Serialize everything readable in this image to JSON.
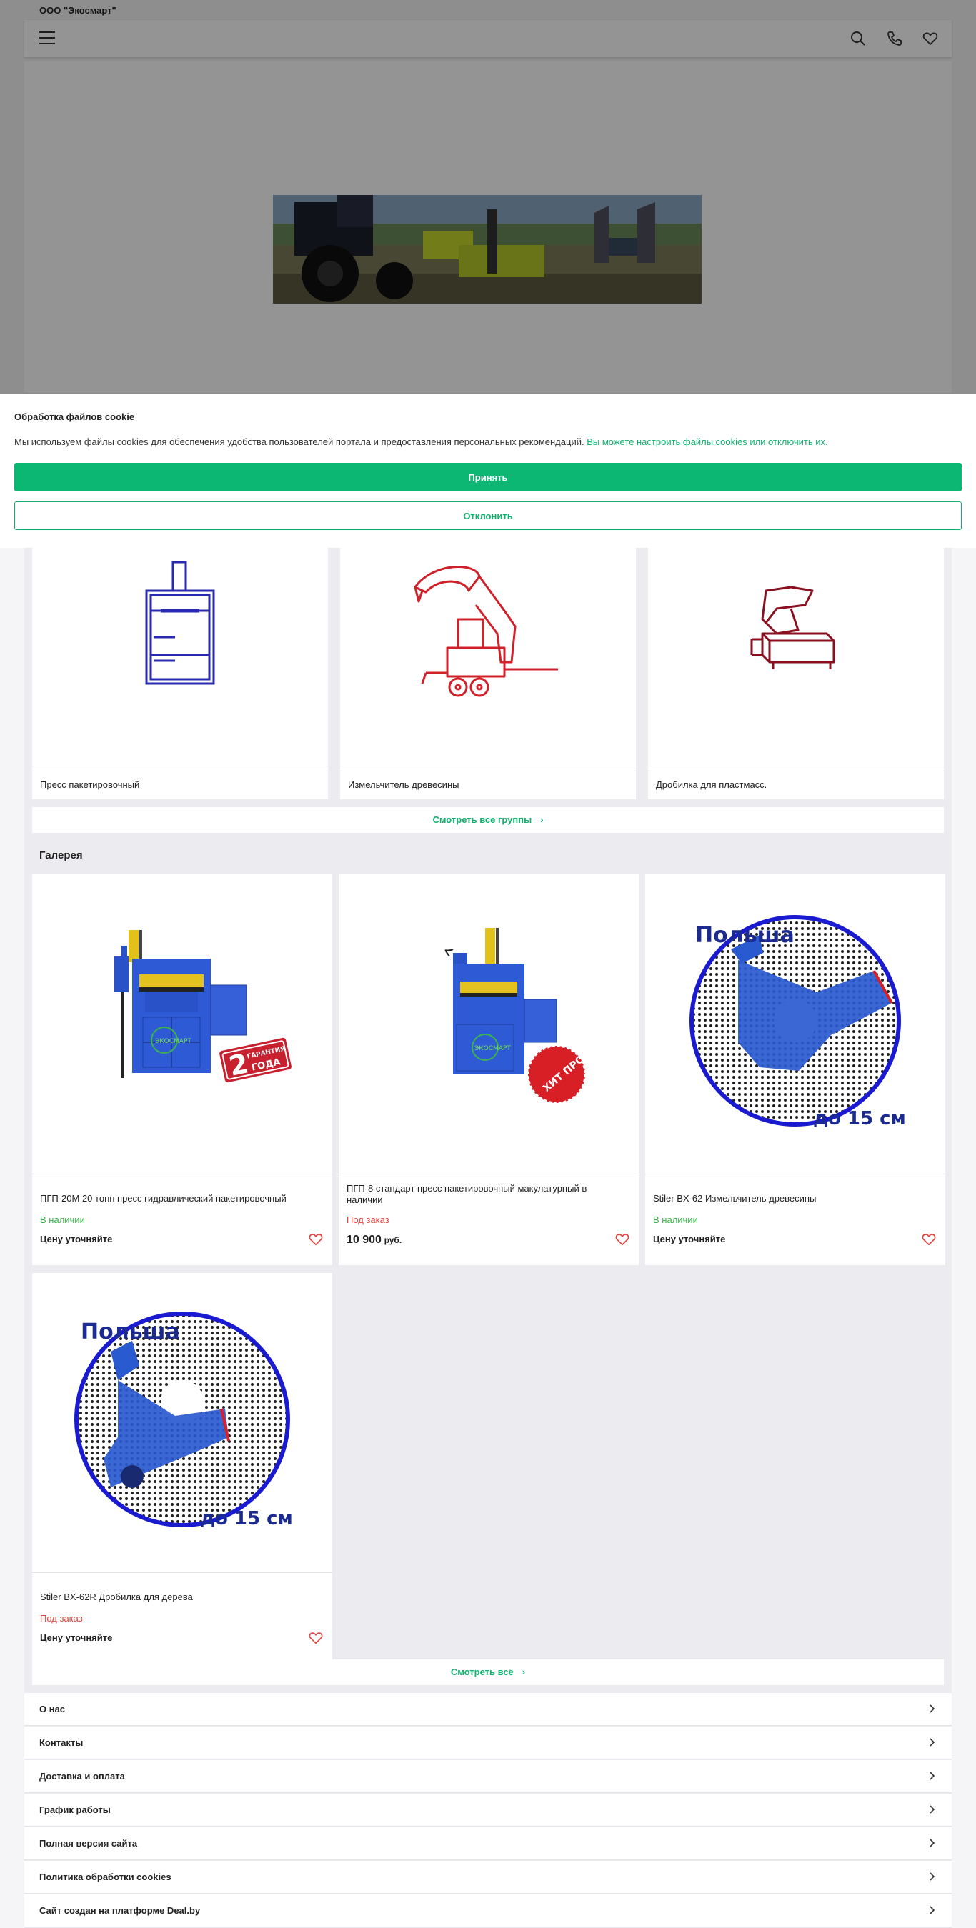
{
  "header": {
    "company": "ООО \"Экосмарт\"",
    "icons": [
      "menu-icon",
      "search-icon",
      "phone-icon",
      "heart-icon"
    ]
  },
  "cookie": {
    "title": "Обработка файлов cookie",
    "text": "Мы используем файлы cookies для обеспечения удобства пользователей портала и предоставления персональных рекомендаций.",
    "link": "Вы можете настроить файлы cookies или отключить их.",
    "accept": "Принять",
    "decline": "Отклонить"
  },
  "categories": [
    {
      "label": "Пресс пакетировочный",
      "icon": "baling-press-icon"
    },
    {
      "label": "Измельчитель древесины",
      "icon": "wood-chipper-icon"
    },
    {
      "label": "Дробилка для пластмасс.",
      "icon": "plastic-crusher-icon"
    }
  ],
  "see_all_groups": "Смотреть все группы",
  "gallery": {
    "title": "Галерея",
    "products": [
      {
        "name": "ПГП-20М 20 тонн пресс гидравлический пакетировочный",
        "status": "В наличии",
        "price": "Цену уточняйте",
        "badge_line1": "ГАРАНТИЯ",
        "badge_num": "2",
        "badge_line2": "ГОДА",
        "logo": "ЭКОСМАРТ"
      },
      {
        "name": "ПГП-8 стандарт пресс пакетировочный макулатурный в наличии",
        "status": "Под заказ",
        "price_value": "10 900",
        "currency": "руб.",
        "badge": "ХИТ ПРОДАЖ",
        "logo": "ЭКОСМАРТ"
      },
      {
        "name": "Stiler BX-62 Измельчитель древесины",
        "status": "В наличии",
        "price": "Цену уточняйте",
        "top_text": "Польша",
        "bottom_text": "до 15 см"
      },
      {
        "name": "Stiler BX-62R Дробилка для дерева",
        "status": "Под заказ",
        "price": "Цену уточняйте",
        "top_text": "Польша",
        "bottom_text": "до 15 см"
      }
    ]
  },
  "see_all": "Смотреть всё",
  "footer_menu": [
    "О нас",
    "Контакты",
    "Доставка и оплата",
    "График работы",
    "Полная версия сайта",
    "Политика обработки cookies",
    "Сайт создан на платформе Deal.by"
  ],
  "colors": {
    "accent": "#0cb673",
    "instock": "#3bb44a",
    "order": "#e2453f"
  }
}
